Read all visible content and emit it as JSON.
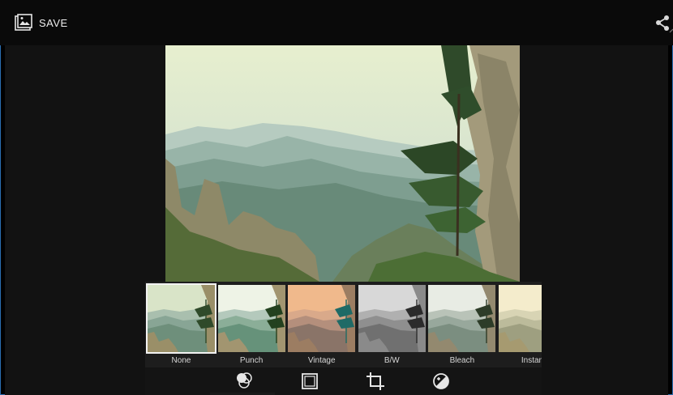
{
  "actionbar": {
    "save_label": "SAVE",
    "save_icon": "gallery-save-icon",
    "share_icon": "share-icon"
  },
  "filters": [
    {
      "label": "None",
      "tone": "none",
      "selected": true
    },
    {
      "label": "Punch",
      "tone": "punch",
      "selected": false
    },
    {
      "label": "Vintage",
      "tone": "vintage",
      "selected": false
    },
    {
      "label": "B/W",
      "tone": "bw",
      "selected": false
    },
    {
      "label": "Bleach",
      "tone": "bleach",
      "selected": false
    },
    {
      "label": "Instan",
      "tone": "instant",
      "selected": false
    }
  ],
  "tools": [
    {
      "name": "filters-tool",
      "icon": "color-filters-icon",
      "active": true
    },
    {
      "name": "frames-tool",
      "icon": "frame-border-icon",
      "active": false
    },
    {
      "name": "crop-tool",
      "icon": "crop-icon",
      "active": false
    },
    {
      "name": "adjust-tool",
      "icon": "exposure-adjust-icon",
      "active": false
    }
  ]
}
